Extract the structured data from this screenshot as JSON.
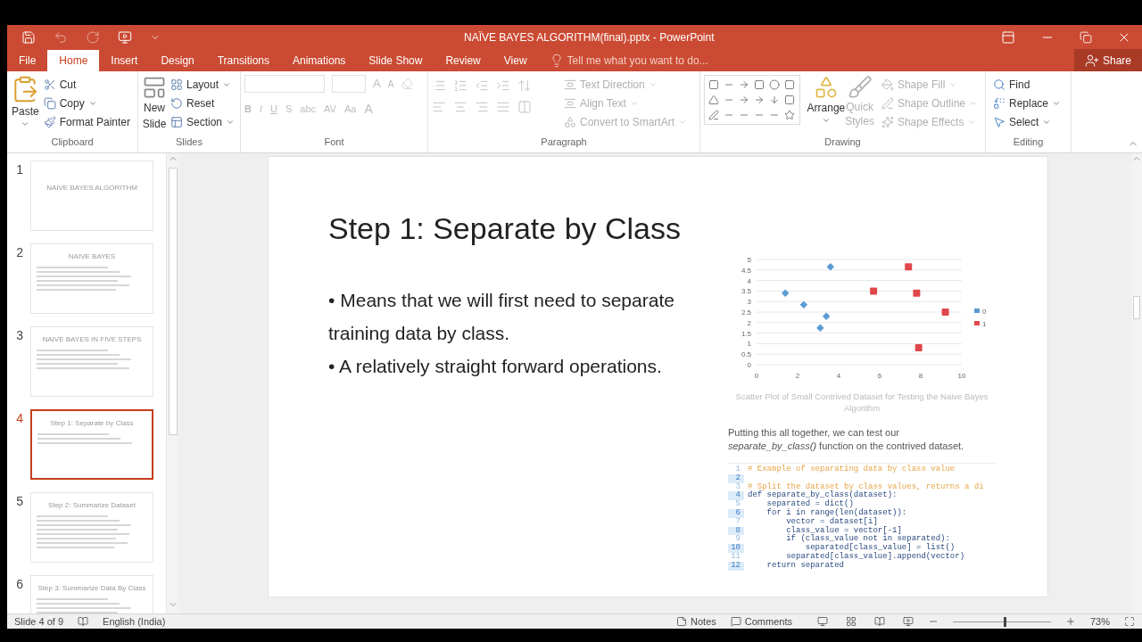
{
  "window": {
    "title": "NAÏVE BAYES ALGORITHM(final).pptx - PowerPoint"
  },
  "tabs": [
    {
      "label": "File",
      "selected": false
    },
    {
      "label": "Home",
      "selected": true
    },
    {
      "label": "Insert",
      "selected": false
    },
    {
      "label": "Design",
      "selected": false
    },
    {
      "label": "Transitions",
      "selected": false
    },
    {
      "label": "Animations",
      "selected": false
    },
    {
      "label": "Slide Show",
      "selected": false
    },
    {
      "label": "Review",
      "selected": false
    },
    {
      "label": "View",
      "selected": false
    }
  ],
  "tell_me": {
    "placeholder": "Tell me what you want to do..."
  },
  "share": "Share",
  "ribbon": {
    "clipboard": {
      "label": "Clipboard",
      "paste": "Paste",
      "items": [
        "Cut",
        "Copy",
        "Format Painter"
      ]
    },
    "slides": {
      "label": "Slides",
      "new_slide": [
        "New",
        "Slide"
      ],
      "items": [
        "Layout",
        "Reset",
        "Section"
      ]
    },
    "font": {
      "label": "Font",
      "size_buttons": [
        "A",
        "A"
      ],
      "buttons": [
        "B",
        "I",
        "U",
        "S",
        "abc",
        "AV",
        "Aa",
        "A"
      ],
      "disabled": true
    },
    "paragraph": {
      "label": "Paragraph",
      "items": [
        {
          "label": "Text Direction",
          "disabled": true
        },
        {
          "label": "Align Text",
          "disabled": true
        },
        {
          "label": "Convert to SmartArt",
          "disabled": true
        }
      ]
    },
    "drawing": {
      "label": "Drawing",
      "arrange": "Arrange",
      "quick_styles": {
        "label": [
          "Quick",
          "Styles"
        ],
        "disabled": true
      },
      "items": [
        {
          "label": "Shape Fill",
          "disabled": true
        },
        {
          "label": "Shape Outline",
          "disabled": true
        },
        {
          "label": "Shape Effects",
          "disabled": true
        }
      ]
    },
    "editing": {
      "label": "Editing",
      "items": [
        "Find",
        "Replace",
        "Select"
      ]
    }
  },
  "slides_pane": [
    {
      "number": "1",
      "title": "NAIVE BAYES ALGORITHM",
      "selected": false,
      "kind": "title"
    },
    {
      "number": "2",
      "title": "NAIVE BAYES",
      "selected": false,
      "kind": "text"
    },
    {
      "number": "3",
      "title": "NAIVE BAYES IN FIVE STEPS",
      "selected": false,
      "kind": "list"
    },
    {
      "number": "4",
      "title": "Step 1: Separate by Class",
      "selected": true,
      "kind": "chart"
    },
    {
      "number": "5",
      "title": "Step 2: Summarize Dataset",
      "selected": false,
      "kind": "code"
    },
    {
      "number": "6",
      "title": "Step 3: Summarize Data By Class",
      "selected": false,
      "kind": "text"
    }
  ],
  "slide": {
    "title": "Step 1: Separate by Class",
    "bullet_marker": "•",
    "bullets": [
      "Means that we will first need to separate training data by class.",
      "A relatively straight forward operations."
    ],
    "chart": {
      "chart_data": {
        "type": "scatter",
        "grid": "y",
        "legend": "right",
        "xlim": [
          0,
          10
        ],
        "ylim": [
          0,
          5
        ],
        "xticks": [
          {
            "value": 0,
            "label": "0"
          },
          {
            "value": 2,
            "label": "2"
          },
          {
            "value": 4,
            "label": "4"
          },
          {
            "value": 6,
            "label": "6"
          },
          {
            "value": 8,
            "label": "8"
          },
          {
            "value": 10,
            "label": "10"
          }
        ],
        "yticks": [
          {
            "value": 0,
            "label": "0"
          },
          {
            "value": 0.5,
            "label": "0.5"
          },
          {
            "value": 1,
            "label": "1"
          },
          {
            "value": 1.5,
            "label": "1.5"
          },
          {
            "value": 2,
            "label": "2"
          },
          {
            "value": 2.5,
            "label": "2.5"
          },
          {
            "value": 3,
            "label": "3"
          },
          {
            "value": 3.5,
            "label": "3.5"
          },
          {
            "value": 4,
            "label": "4"
          },
          {
            "value": 4.5,
            "label": "4.5"
          },
          {
            "value": 5,
            "label": "5"
          }
        ],
        "series": [
          {
            "name": "0",
            "color": "#5b9bd5",
            "x": [
              1.4,
              2.3,
              3.1,
              3.4,
              3.6
            ],
            "values": [
              3.4,
              2.85,
              1.75,
              2.3,
              4.65
            ]
          },
          {
            "name": "1",
            "color": "#e0474c",
            "x": [
              5.7,
              7.4,
              7.8,
              9.2,
              7.9
            ],
            "values": [
              3.5,
              4.65,
              3.4,
              2.5,
              0.8
            ]
          }
        ]
      },
      "caption": "Scatter Plot of Small Contrived Dataset for Testing the Naive Bayes Algorithm"
    },
    "paragraph": "Putting this all together, we can test our *separate_by_class()* function on the contrived dataset.",
    "code_lines": [
      {
        "number": "1",
        "text": "# Example of separating data by class value",
        "kind": "comment"
      },
      {
        "number": "2",
        "kind": "blank"
      },
      {
        "number": "3",
        "text": "# Split the dataset by class values, returns a di",
        "kind": "comment"
      },
      {
        "number": "4",
        "text": "def separate_by_class(dataset):",
        "kind": "code"
      },
      {
        "number": "5",
        "text": "    separated = dict()",
        "kind": "code"
      },
      {
        "number": "6",
        "text": "    for i in range(len(dataset)):",
        "kind": "code"
      },
      {
        "number": "7",
        "text": "        vector = dataset[i]",
        "kind": "code"
      },
      {
        "number": "8",
        "text": "        class_value = vector[-1]",
        "kind": "code"
      },
      {
        "number": "9",
        "text": "        if (class_value not in separated):",
        "kind": "code"
      },
      {
        "number": "10",
        "text": "            separated[class_value] = list()",
        "kind": "code"
      },
      {
        "number": "11",
        "text": "        separated[class_value].append(vector)",
        "kind": "code"
      },
      {
        "number": "12",
        "text": "    return separated",
        "kind": "code"
      }
    ]
  },
  "status_bar": {
    "slide": "Slide 4 of 9",
    "language": "English (India)",
    "notes": "Notes",
    "comments": "Comments",
    "zoom": "73%",
    "level": 0.52
  }
}
